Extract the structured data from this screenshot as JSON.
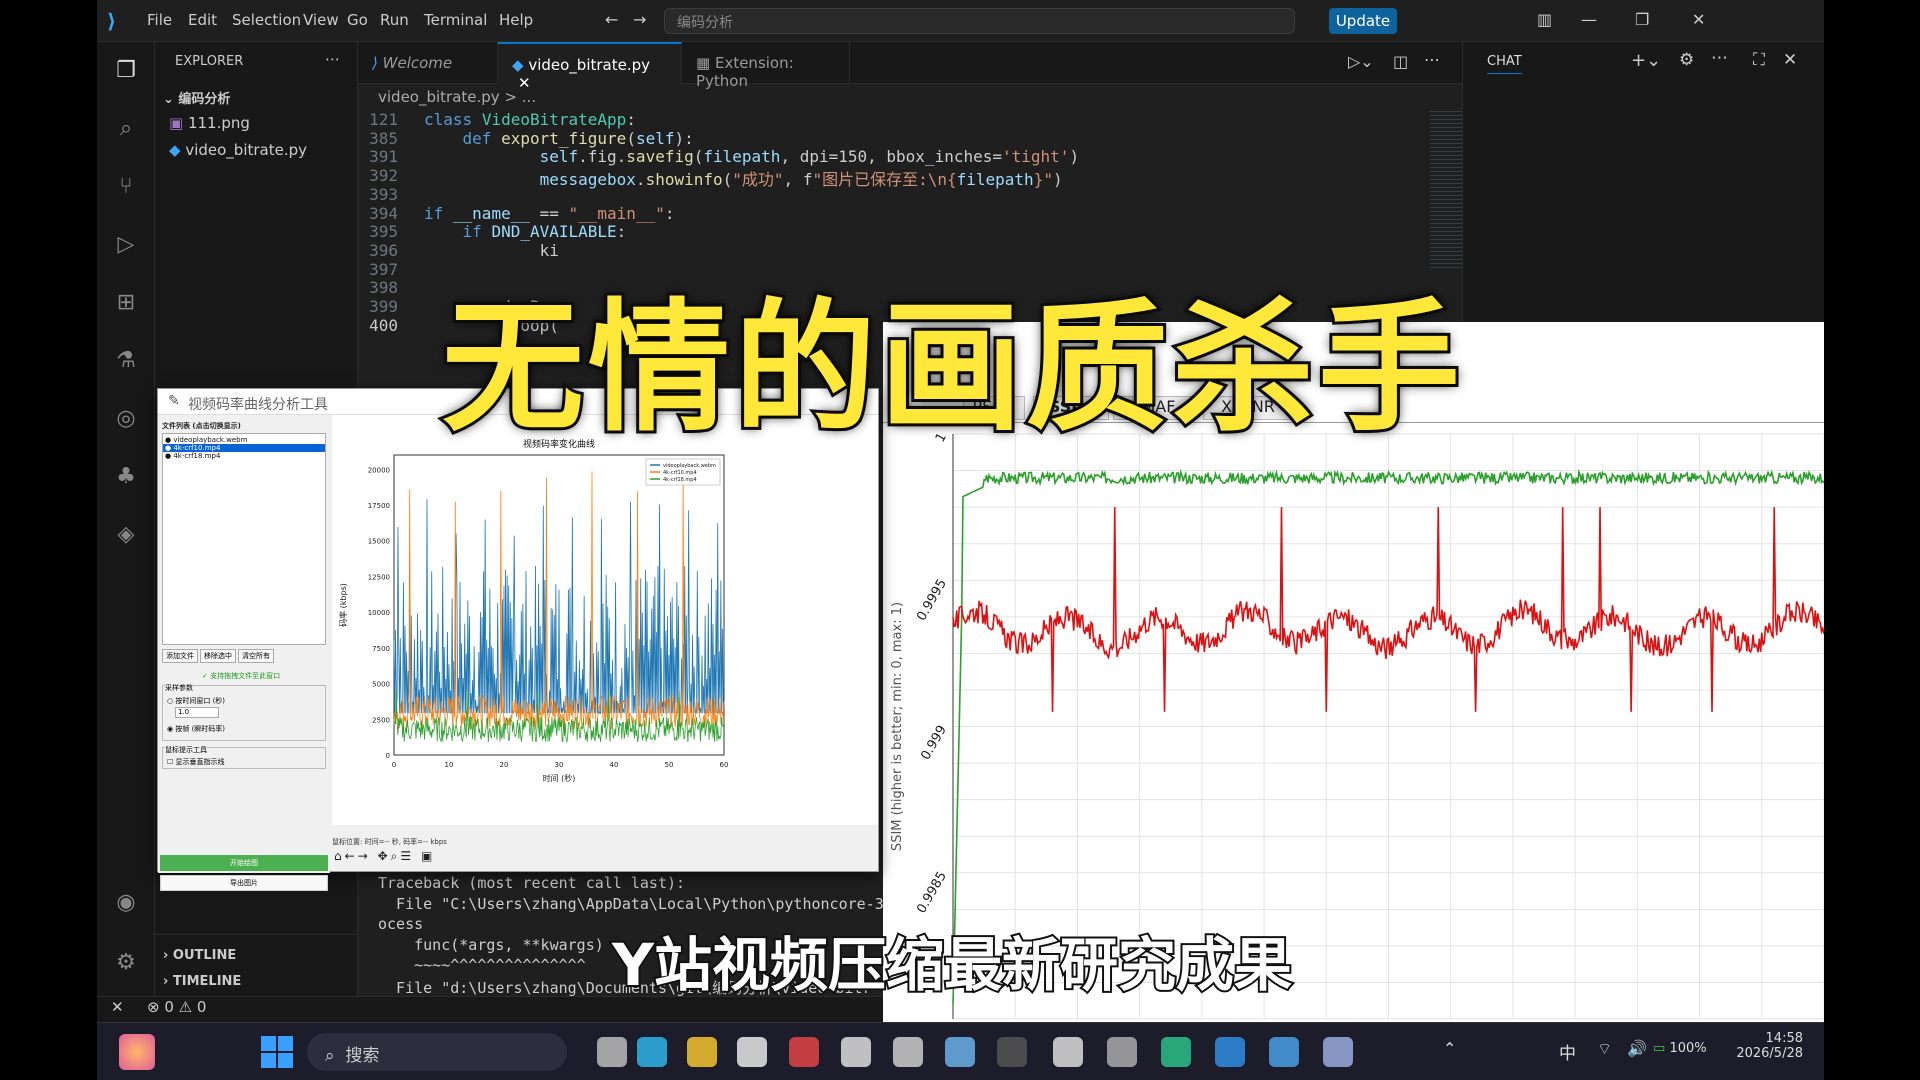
{
  "menu": [
    "File",
    "Edit",
    "Selection",
    "View",
    "Go",
    "Run",
    "Terminal",
    "Help"
  ],
  "command_center": "编码分析",
  "update_label": "Update",
  "explorer": {
    "title": "EXPLORER",
    "folder": "编码分析",
    "files": [
      "111.png",
      "video_bitrate.py"
    ],
    "outline": "OUTLINE",
    "timeline": "TIMELINE"
  },
  "tabs": [
    "Welcome",
    "video_bitrate.py",
    "Extension: Python"
  ],
  "breadcrumb": "video_bitrate.py > ...",
  "chat_title": "CHAT",
  "code": [
    {
      "n": "121",
      "t": "class VideoBitrateApp:"
    },
    {
      "n": "385",
      "t": "    def export_figure(self):"
    },
    {
      "n": "391",
      "t": "            self.fig.savefig(filepath, dpi=150, bbox_inches='tight')"
    },
    {
      "n": "392",
      "t": "            messagebox.showinfo(\"成功\", f\"图片已保存至:\\n{filepath}\")"
    },
    {
      "n": "393",
      "t": ""
    },
    {
      "n": "394",
      "t": "if __name__ == \"__main__\":"
    },
    {
      "n": "395",
      "t": "    if DND_AVAILABLE:"
    },
    {
      "n": "396",
      "t": "            ki"
    },
    {
      "n": "397",
      "t": ""
    },
    {
      "n": "398",
      "t": ""
    },
    {
      "n": "399",
      "t": "    a   deoB"
    },
    {
      "n": "400",
      "t": "        nloop("
    }
  ],
  "terminal": [
    "Traceback (most recent call last):",
    "  File \"C:\\Users\\zhang\\AppData\\Local\\Python\\pythoncore-3",
    "ocess",
    "    func(*args, **kwargs)",
    "    ~~~~^^^^^^^^^^^^^^^",
    "  File \"d:\\Users\\zhang\\Documents\\git\\编码分析\\video_bitr"
  ],
  "status": {
    "errors": "0",
    "warnings": "0"
  },
  "tool": {
    "title": "视频码率曲线分析工具",
    "list_label": "文件列表 (点击切换显示)",
    "files": [
      "videoplayback.webm",
      "4k-crf10.mp4",
      "4k-crf18.mp4"
    ],
    "buttons": [
      "添加文件",
      "移除选中",
      "清空所有"
    ],
    "drag_hint": "✓ 支持拖拽文件至此窗口",
    "sampling_label": "采样参数",
    "opt_time": "按时间窗口 (秒)",
    "window_value": "1.0",
    "opt_frame": "按帧 (瞬时码率)",
    "mouse_label": "鼠标提示工具",
    "show_line": "显示垂直指示线",
    "start_btn": "开始绘图",
    "export_btn": "导出图片",
    "cursor_info": "鼠标位置: 时间=-- 秒, 码率=-- kbps"
  },
  "chart_data": [
    {
      "type": "line",
      "title": "视频码率变化曲线",
      "xlabel": "时间 (秒)",
      "ylabel": "码率 (kbps)",
      "xlim": [
        0,
        60
      ],
      "ylim": [
        0,
        21000
      ],
      "xticks": [
        "0",
        "10",
        "20",
        "30",
        "40",
        "50",
        "60"
      ],
      "yticks": [
        "0",
        "2500",
        "5000",
        "7500",
        "10000",
        "12500",
        "15000",
        "17500",
        "20000"
      ],
      "legend": [
        "videoplayback.webm",
        "4k-crf10.mp4",
        "4k-crf18.mp4"
      ],
      "legend_position": "top-right",
      "series": [
        {
          "name": "videoplayback.webm",
          "color": "#1f77b4",
          "mean": 6500,
          "peak": 18000
        },
        {
          "name": "4k-crf10.mp4",
          "color": "#ff7f0e",
          "mean": 3000,
          "peak": 20000
        },
        {
          "name": "4k-crf18.mp4",
          "color": "#2ca02c",
          "mean": 1800,
          "peak": 5000
        }
      ]
    },
    {
      "type": "line",
      "tabs": [
        "PSNR",
        "SSIM",
        "VMAF",
        "XPSNR"
      ],
      "active_tab": "SSIM",
      "ylabel": "SSIM (higher is better; min: 0, max: 1)",
      "yticks": [
        "0.9985",
        "0.999",
        "0.9995",
        "1"
      ],
      "ylim": [
        0.998,
        1.0
      ],
      "grid": true,
      "series": [
        {
          "color": "#2ca02c",
          "level": 0.99985
        },
        {
          "color": "#dd1111",
          "level": 0.99935
        }
      ]
    }
  ],
  "overlay": {
    "title": "无情的画质杀手",
    "subtitle": "Y站视频压缩最新研究成果"
  },
  "taskbar": {
    "search": "搜索",
    "time": "14:58",
    "date": "2026/5/28",
    "battery": "100%",
    "ime": "中"
  }
}
